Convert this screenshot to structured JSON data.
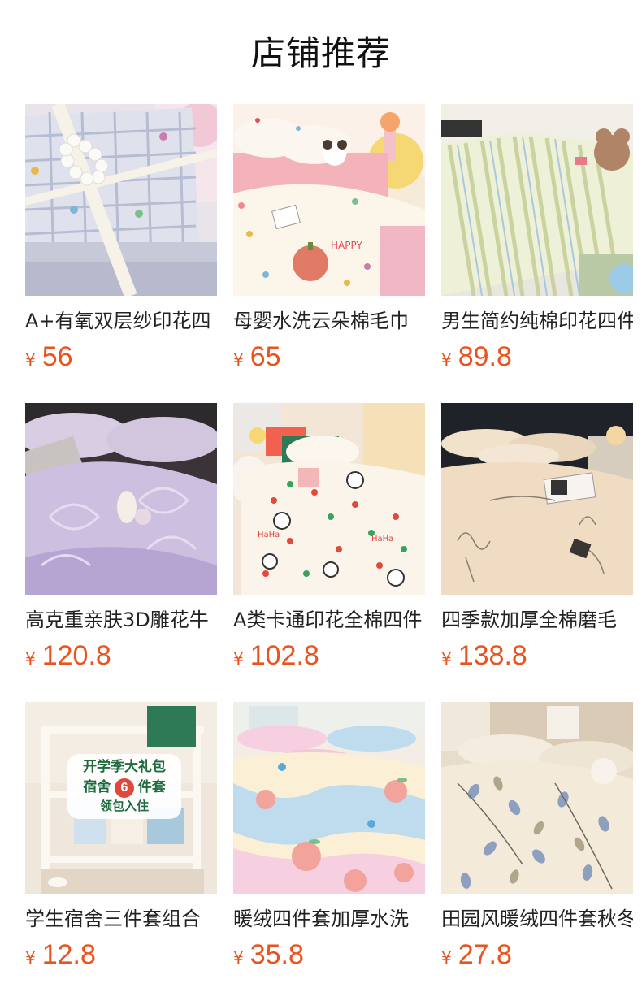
{
  "header": {
    "title": "店铺推荐"
  },
  "currency_symbol": "¥",
  "products": [
    {
      "name": "A+有氧双层纱印花四",
      "price": "56",
      "image": "gray-plaid-bedding-with-pearls"
    },
    {
      "name": "母婴水洗云朵棉毛巾",
      "price": "65",
      "image": "pink-polka-dot-bedding-with-pumpkin"
    },
    {
      "name": "男生简约纯棉印花四件",
      "price": "89.8",
      "image": "green-striped-bedding-with-teddy-bear"
    },
    {
      "name": "高克重亲肤3D雕花牛",
      "price": "120.8",
      "image": "lavender-embossed-plush-bedding"
    },
    {
      "name": "A类卡通印花全棉四件",
      "price": "102.8",
      "image": "cartoon-dog-print-bedding"
    },
    {
      "name": "四季款加厚全棉磨毛",
      "price": "138.8",
      "image": "beige-embroidered-bedding"
    },
    {
      "name": "学生宿舍三件套组合",
      "price": "12.8",
      "image": "dorm-bundle-bunk-bed",
      "overlay": {
        "line1": "开学季大礼包",
        "line2a": "宿舍",
        "badge": "6",
        "line2b": "件套",
        "line3": "领包入住"
      }
    },
    {
      "name": "暖绒四件套加厚水洗",
      "price": "35.8",
      "image": "pastel-peach-print-bedding"
    },
    {
      "name": "田园风暖绒四件套秋冬",
      "price": "27.8",
      "image": "floral-leaf-print-bedding"
    }
  ]
}
